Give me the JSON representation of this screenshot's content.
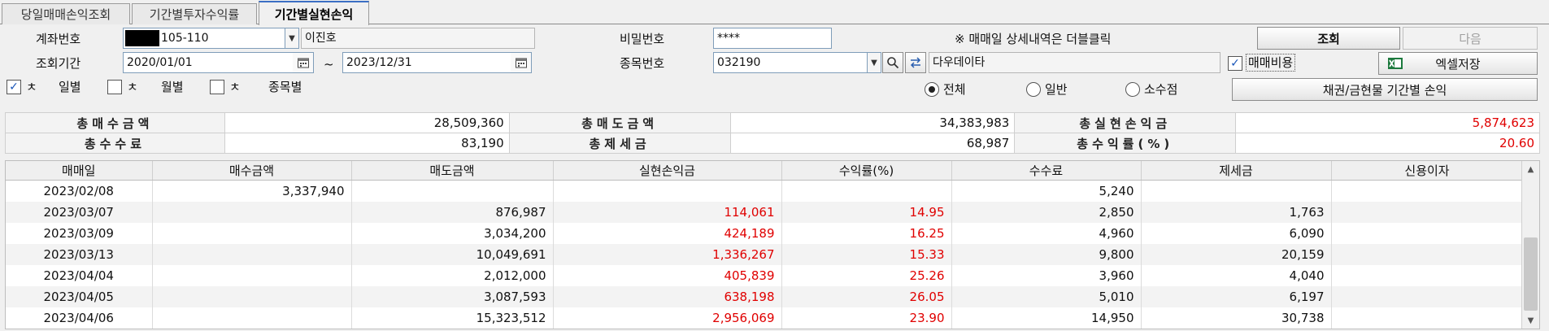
{
  "tabs": [
    "당일매매손익조회",
    "기간별투자수익률",
    "기간별실현손익"
  ],
  "form": {
    "account_label": "계좌번호",
    "account_number": "105-110",
    "account_name": "이진호",
    "password_label": "비밀번호",
    "password_value": "****",
    "notice": "※ 매매일 상세내역은 더블클릭",
    "period_label": "조회기간",
    "date_from": "2020/01/01",
    "tilde": "~",
    "date_to": "2023/12/31",
    "stock_label": "종목번호",
    "stock_code": "032190",
    "stock_name": "다우데이타",
    "trade_cost_label": "매매비용",
    "daily_chk_label": "ㅊ",
    "daily_label": "일별",
    "monthly_chk_label": "ㅊ",
    "monthly_label": "월별",
    "stock_chk_label": "ㅊ",
    "by_stock_label": "종목별",
    "radio_all": "전체",
    "radio_normal": "일반",
    "radio_fraction": "소수점"
  },
  "buttons": {
    "search": "조회",
    "next": "다음",
    "excel": "엑셀저장",
    "bond": "채권/금현물 기간별 손익"
  },
  "summary": {
    "buy_total_label": "총매수금액",
    "buy_total": "28,509,360",
    "sell_total_label": "총매도금액",
    "sell_total": "34,383,983",
    "realized_label": "총실현손익금",
    "realized": "5,874,623",
    "fee_label": "총수수료",
    "fee": "83,190",
    "tax_label": "총제세금",
    "tax": "68,987",
    "rate_label": "총수익률(%)",
    "rate": "20.60"
  },
  "grid": {
    "columns": [
      "매매일",
      "매수금액",
      "매도금액",
      "실현손익금",
      "수익률(%)",
      "수수료",
      "제세금",
      "신용이자"
    ],
    "rows": [
      [
        "2023/02/08",
        "3,337,940",
        "",
        "",
        "",
        "5,240",
        "",
        ""
      ],
      [
        "2023/03/07",
        "",
        "876,987",
        "114,061",
        "14.95",
        "2,850",
        "1,763",
        ""
      ],
      [
        "2023/03/09",
        "",
        "3,034,200",
        "424,189",
        "16.25",
        "4,960",
        "6,090",
        ""
      ],
      [
        "2023/03/13",
        "",
        "10,049,691",
        "1,336,267",
        "15.33",
        "9,800",
        "20,159",
        ""
      ],
      [
        "2023/04/04",
        "",
        "2,012,000",
        "405,839",
        "25.26",
        "3,960",
        "4,040",
        ""
      ],
      [
        "2023/04/05",
        "",
        "3,087,593",
        "638,198",
        "26.05",
        "5,010",
        "6,197",
        ""
      ],
      [
        "2023/04/06",
        "",
        "15,323,512",
        "2,956,069",
        "23.90",
        "14,950",
        "30,738",
        ""
      ]
    ]
  },
  "colors": {
    "profit": "#e00000",
    "tab_accent": "#3b6fc4"
  }
}
